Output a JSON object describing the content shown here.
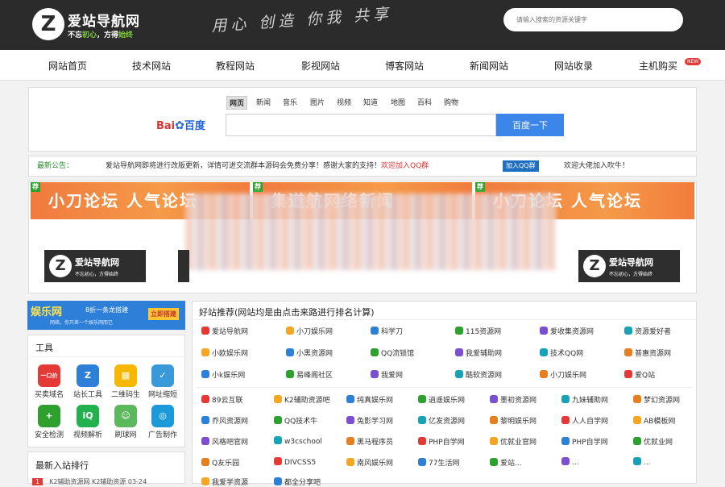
{
  "header": {
    "logo_letter": "Z",
    "logo_name": "爱站导航网",
    "slogan_a": "不忘",
    "slogan_b": "初心",
    "slogan_c": "，方得",
    "slogan_d": "始终",
    "motto": "用心 创造 你我 共享",
    "search_placeholder": "请输入搜索的资源关键字"
  },
  "nav": {
    "items": [
      "网站首页",
      "技术网站",
      "教程网站",
      "影视网站",
      "博客网站",
      "新闻网站",
      "网站收录",
      "主机购买"
    ],
    "new_badge": "NEW"
  },
  "search": {
    "tabs": [
      "网页",
      "新闻",
      "音乐",
      "图片",
      "视频",
      "知道",
      "地图",
      "百科",
      "购物"
    ],
    "engine_bai": "Bai",
    "engine_paw": "✿",
    "engine_du": "百度",
    "button": "百度一下"
  },
  "notice": {
    "label": "最新公告：",
    "message": "爱站导航网即将进行改版更新，详情可进交流群本源码会免费分享！感谢大家的支持！",
    "qq_text": "欢迎加入QQ群",
    "qq_button": "加入QQ群",
    "welcome": "欢迎大佬加入吹牛！"
  },
  "banners": [
    {
      "tag": "荐",
      "text": "小刀论坛 人气论坛"
    },
    {
      "tag": "荐",
      "text": "集道航网络新闻"
    },
    {
      "tag": "荐",
      "text": "小刀论坛 人气论坛"
    }
  ],
  "ad_logo": {
    "name": "爱站导航网",
    "slogan": "不忘初心，方得始终"
  },
  "promo": {
    "title": "娱乐网",
    "sub": "8折一条龙搭建",
    "line": "网络，你只差一个娱乐网而已",
    "button": "立即搭建"
  },
  "tools": {
    "title": "工具",
    "items": [
      {
        "label": "买卖域名",
        "icon": "domain-icon",
        "glyph": "一口价",
        "color": "#e53935"
      },
      {
        "label": "站长工具",
        "icon": "z-tool-icon",
        "glyph": "Z",
        "color": "#2e7fd8"
      },
      {
        "label": "二维码生",
        "icon": "qrcode-icon",
        "glyph": "▦",
        "color": "#f5b700"
      },
      {
        "label": "网址缩短",
        "icon": "shield-check-icon",
        "glyph": "✓",
        "color": "#3a9ad9"
      },
      {
        "label": "安全检测",
        "icon": "shield-plus-icon",
        "glyph": "+",
        "color": "#2ea02e"
      },
      {
        "label": "视频解析",
        "icon": "iqiyi-icon",
        "glyph": "iQ",
        "color": "#22b14c"
      },
      {
        "label": "刷球网",
        "icon": "frog-icon",
        "glyph": "☺",
        "color": "#5cb85c"
      },
      {
        "label": "广告制作",
        "icon": "ad-icon",
        "glyph": "◎",
        "color": "#1a9ad9"
      }
    ]
  },
  "ranking": {
    "title": "最新入站排行",
    "first": {
      "num": "1",
      "text": "K2辅助资源网 K2辅助资源 03-24"
    }
  },
  "recommend": {
    "title": "好站推荐(网站均是由点击来路进行排名计算)",
    "group1": [
      [
        "爱站导航网",
        "小刀娱乐网",
        "科学刀",
        "115资源网",
        "爱收集资源网",
        "资源爱好者"
      ],
      [
        "小欧娱乐网",
        "小黑资源网",
        "QQ流锁馆",
        "我爱辅助网",
        "技术QQ网",
        "普惠资源网"
      ],
      [
        "小k娱乐网",
        "易峰阁社区",
        "我爱网",
        "酷软资源网",
        "小刀娱乐网",
        "爱Q站"
      ]
    ],
    "group2": [
      [
        "89云互联",
        "K2辅助资源吧",
        "纯真娱乐网",
        "逍遥娱乐网",
        "墨初资源网",
        "九妹辅助网",
        "梦幻资源网"
      ],
      [
        "乔风资源网",
        "QQ技术牛",
        "兔影学习网",
        "亿发资源网",
        "黎明娱乐网",
        "人人自学网",
        "AB模板网"
      ],
      [
        "风格吧官网",
        "w3cschool",
        "黑马程序员",
        "PHP自学网",
        "优就业官网",
        "PHP自学网",
        "优就业网"
      ],
      [
        "Q友乐园",
        "DIVCSS5",
        "南风娱乐网",
        "77生活网",
        "爱站...",
        "...",
        "..."
      ],
      [
        "我爱学资源",
        "都全分享吧",
        "",
        "",
        "",
        "",
        ""
      ]
    ],
    "icon_colors": [
      "#e53935",
      "#f5a623",
      "#2e7fd8",
      "#2ea02e",
      "#7b4fcf",
      "#17a2b8",
      "#e67e22"
    ]
  }
}
